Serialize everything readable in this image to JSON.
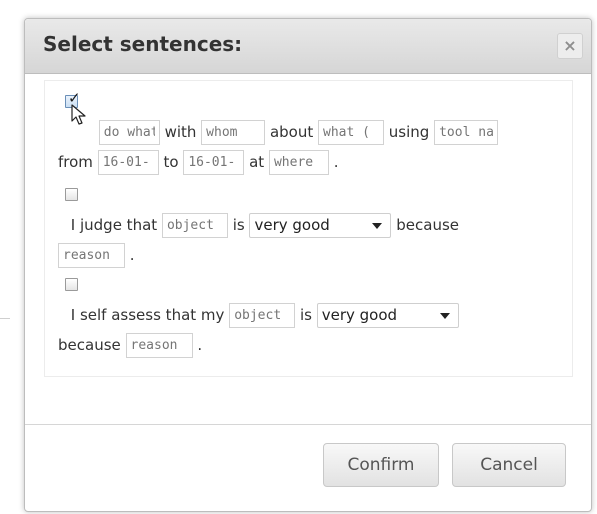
{
  "dialog": {
    "title": "Select sentences:",
    "close_label": "×",
    "confirm_label": "Confirm",
    "cancel_label": "Cancel"
  },
  "sentence1": {
    "checked": true,
    "check_mark": "✓",
    "activity_placeholder": "do what",
    "with_text": "with",
    "whom_placeholder": "whom",
    "about_text": "about",
    "what_placeholder": "what (",
    "using_text": "using",
    "tool_placeholder": "tool name",
    "from_text": "from",
    "from_date_placeholder": "16-01-",
    "to_text": "to",
    "to_date_placeholder": "16-01-",
    "at_text": "at",
    "where_placeholder": "where",
    "end_text": "."
  },
  "sentence2": {
    "checked": false,
    "lead_text": "I judge that",
    "object_placeholder": "object",
    "is_text": "is",
    "rating_selected": "very good",
    "because_text": "because",
    "reason_placeholder": "reason",
    "end_text": "."
  },
  "sentence3": {
    "checked": false,
    "lead_text": "I self assess that my",
    "object_placeholder": "object",
    "is_text": "is",
    "rating_selected": "very good",
    "because_text": "because",
    "reason_placeholder": "reason",
    "end_text": "."
  },
  "icons": {
    "close": "close-icon",
    "checkbox": "checkbox-icon",
    "cursor": "mouse-pointer-icon",
    "dropdown": "chevron-down-icon"
  }
}
